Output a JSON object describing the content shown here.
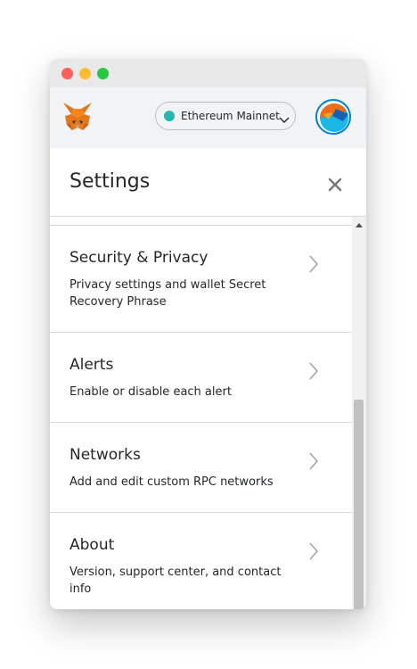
{
  "window": {
    "controls": [
      "close",
      "minimize",
      "zoom"
    ]
  },
  "header": {
    "logo_icon": "metamask-fox-icon",
    "network": {
      "label": "Ethereum Mainnet",
      "dot_color": "#29b6af"
    },
    "account_icon": "account-avatar-icon"
  },
  "settings": {
    "title": "Settings",
    "close_icon": "close-icon",
    "items": [
      {
        "title": "Security & Privacy",
        "description": "Privacy settings and wallet Secret Recovery Phrase"
      },
      {
        "title": "Alerts",
        "description": "Enable or disable each alert"
      },
      {
        "title": "Networks",
        "description": "Add and edit custom RPC networks"
      },
      {
        "title": "About",
        "description": "Version, support center, and contact info"
      }
    ]
  },
  "colors": {
    "accent": "#037dd6",
    "text": "#24272a",
    "divider": "#d6d9dc",
    "header_bg": "#f2f3f4"
  }
}
